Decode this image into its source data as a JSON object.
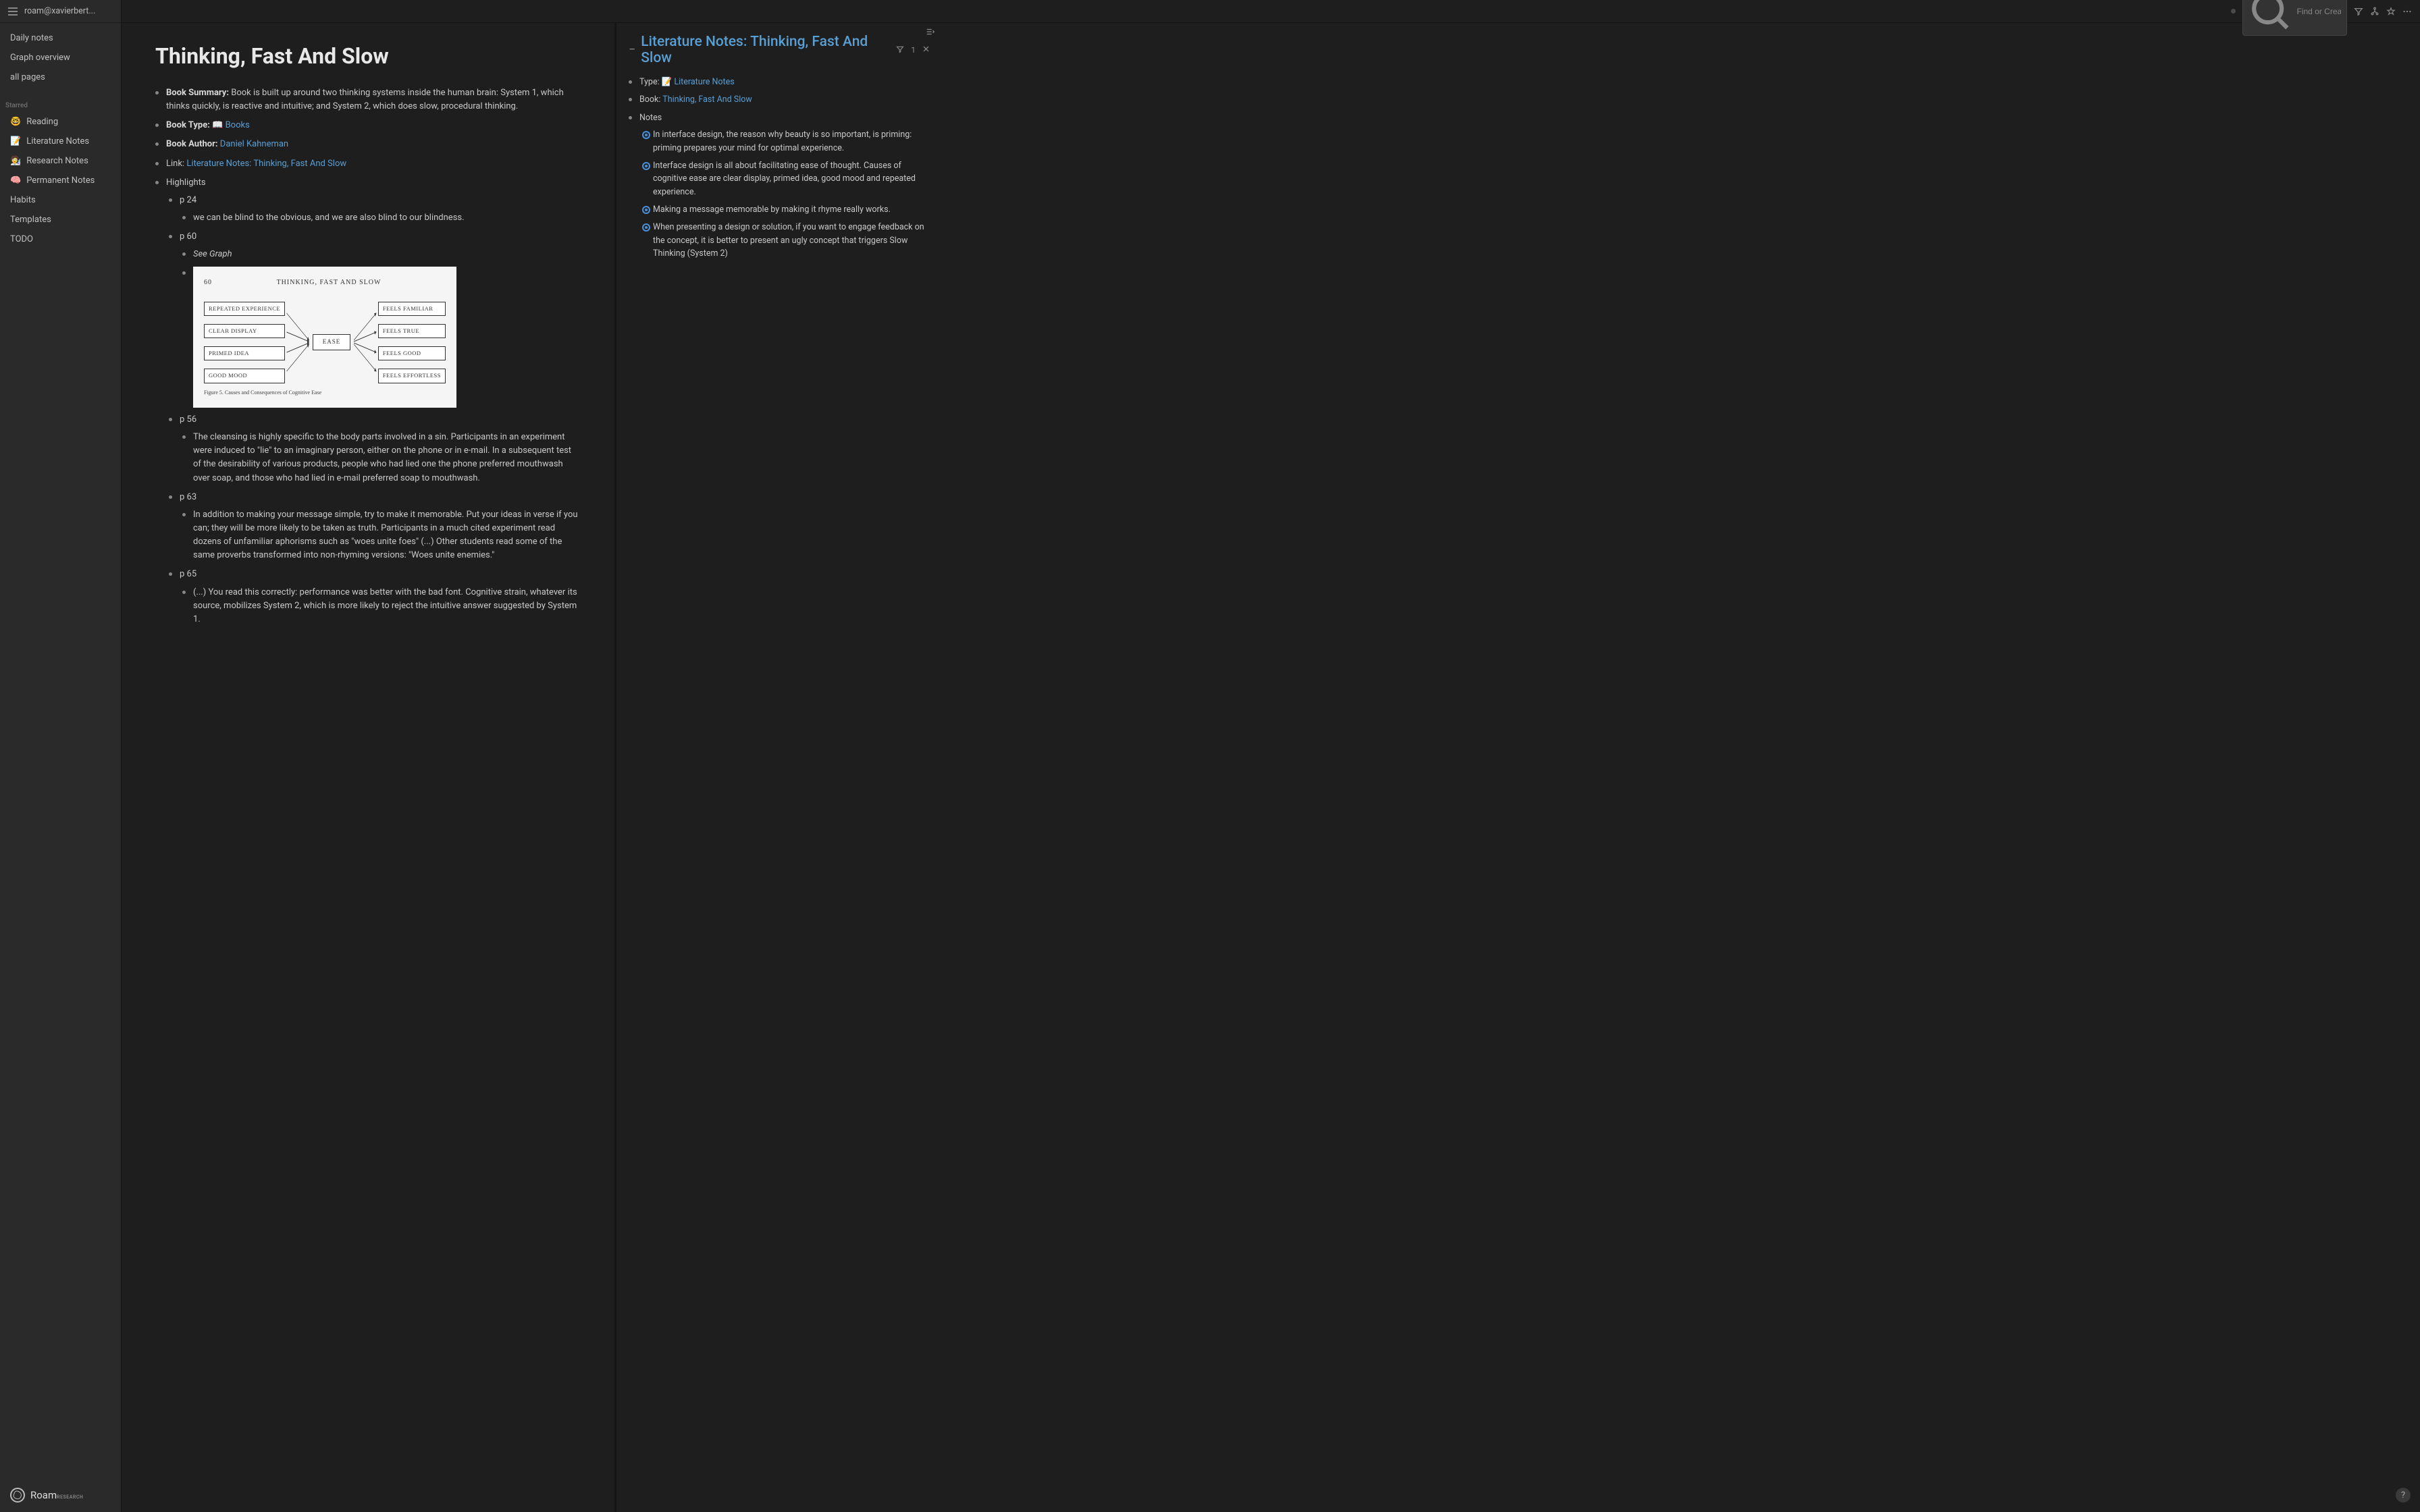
{
  "sidebar": {
    "workspace": "roam@xavierbert...",
    "nav": [
      {
        "label": "Daily notes"
      },
      {
        "label": "Graph overview"
      },
      {
        "label": "all pages"
      }
    ],
    "starred_label": "Starred",
    "starred": [
      {
        "emoji": "🤓",
        "label": "Reading"
      },
      {
        "emoji": "📝",
        "label": "Literature Notes"
      },
      {
        "emoji": "🧑‍🔬",
        "label": "Research Notes"
      },
      {
        "emoji": "🧠",
        "label": "Permanent Notes"
      }
    ],
    "extra": [
      {
        "label": "Habits"
      },
      {
        "label": "Templates"
      },
      {
        "label": "TODO"
      }
    ],
    "brand": "Roam",
    "brand_sub": "RESEARCH"
  },
  "topbar": {
    "search_placeholder": "Find or Create Page"
  },
  "page": {
    "title": "Thinking, Fast And Slow",
    "summary_label": "Book Summary:",
    "summary_text": " Book is built up around two thinking systems inside the human brain: System 1, which thinks quickly, is reactive and intuitive; and System 2, which does slow, procedural thinking.",
    "type_label": "Book Type:",
    "type_icon": "📖",
    "type_link": "Books",
    "author_label": "Book Author:",
    "author_link": "Daniel Kahneman",
    "link_label": "Link:",
    "link_link": "Literature Notes: Thinking, Fast And Slow",
    "highlights_label": "Highlights",
    "p24_label": "p 24",
    "p24_text": "we can be blind to the obvious, and we are also blind to our blindness.",
    "p60_label": "p 60",
    "p60_italic": "See Graph",
    "graph_page": "60",
    "graph_title": "THINKING, FAST AND SLOW",
    "graph_left": [
      "REPEATED EXPERIENCE",
      "CLEAR DISPLAY",
      "PRIMED IDEA",
      "GOOD MOOD"
    ],
    "graph_center": "EASE",
    "graph_right": [
      "FEELS FAMILIAR",
      "FEELS TRUE",
      "FEELS GOOD",
      "FEELS EFFORTLESS"
    ],
    "graph_caption": "Figure 5. Causes and Consequences of Cognitive Ease",
    "p56_label": "p 56",
    "p56_text": "The cleansing is highly specific to the body parts involved in a sin. Participants in an experiment were induced to \"lie\" to an imaginary person, either on the phone or in e-mail. In a subsequent test of the desirability of various products, people who had lied one the phone preferred mouthwash over soap, and those who had lied in e-mail preferred soap to mouthwash.",
    "p63_label": "p 63",
    "p63_text": "In addition to making your message simple, try to make it memorable. Put your ideas in verse if you can; they will be more likely to be taken as truth. Participants in a much cited experiment read dozens of unfamiliar aphorisms such as \"woes unite foes\" (...) Other students read some of the same proverbs transformed into non-rhyming versions: \"Woes unite enemies.\"",
    "p65_label": "p 65",
    "p65_text": "(...) You read this correctly: performance was better with the bad font. Cognitive strain, whatever its source, mobilizes System 2, which is more likely to reject the intuitive answer suggested by System 1."
  },
  "right": {
    "title": "Literature Notes: Thinking, Fast And Slow",
    "count": "1",
    "type_label": "Type:",
    "type_icon": "📝",
    "type_link": "Literature Notes",
    "book_label": "Book:",
    "book_link": "Thinking, Fast And Slow",
    "notes_label": "Notes",
    "note1": "In interface design, the reason why beauty is so important, is priming: priming prepares your mind for optimal experience.",
    "note2": "Interface design is all about facilitating ease of thought. Causes of cognitive ease are clear display, primed idea, good mood and repeated experience.",
    "note3": "Making a message memorable by making it rhyme really works.",
    "note4": "When presenting a design or solution, if you want to engage feedback on the concept, it is better to present an ugly concept that triggers Slow Thinking (System 2)"
  },
  "help": "?"
}
